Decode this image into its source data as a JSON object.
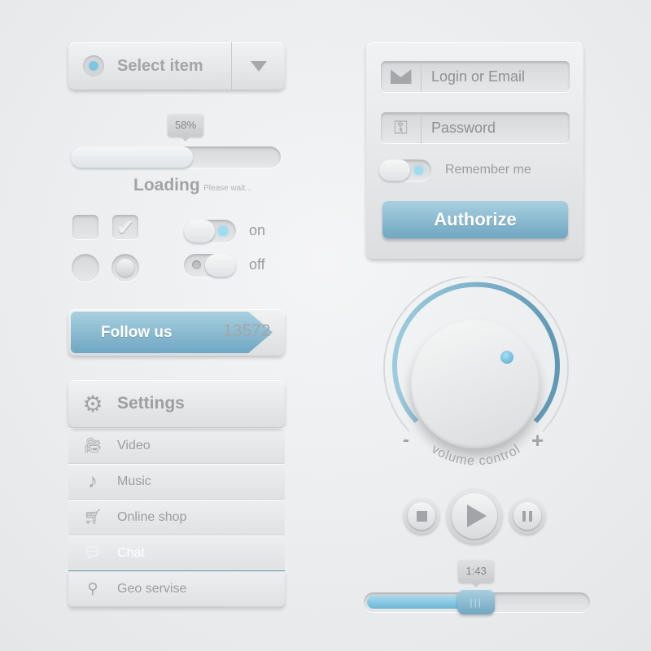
{
  "select": {
    "label": "Select item",
    "icon": "chevron-down-icon"
  },
  "progress": {
    "percent": 58,
    "label": "58%",
    "title": "Loading",
    "subtitle": "Please wait..."
  },
  "checkboxes": [
    {
      "checked": false
    },
    {
      "checked": true
    }
  ],
  "radios": [
    {
      "selected": false
    },
    {
      "selected": true
    }
  ],
  "toggles": [
    {
      "label": "on",
      "state": true
    },
    {
      "label": "off",
      "state": false
    }
  ],
  "follow": {
    "label": "Follow us",
    "count": "13572"
  },
  "settings": {
    "title": "Settings",
    "items": [
      {
        "label": "Video",
        "icon": "video-camera-icon"
      },
      {
        "label": "Music",
        "icon": "music-note-icon"
      },
      {
        "label": "Online shop",
        "icon": "cart-icon"
      },
      {
        "label": "Chat",
        "icon": "chat-icon",
        "active": true
      },
      {
        "label": "Geo servise",
        "icon": "map-pin-icon"
      }
    ]
  },
  "login": {
    "email_placeholder": "Login or Email",
    "password_placeholder": "Password",
    "remember_label": "Remember me",
    "remember": true,
    "submit": "Authorize"
  },
  "volume": {
    "label": "volume control",
    "minus": "-",
    "plus": "+"
  },
  "player": {
    "time": "1:43",
    "position_percent": 45
  },
  "colors": {
    "accent": "#7fb5cd",
    "accent_dark": "#5f9ab6",
    "led": "#6fc3e6"
  }
}
